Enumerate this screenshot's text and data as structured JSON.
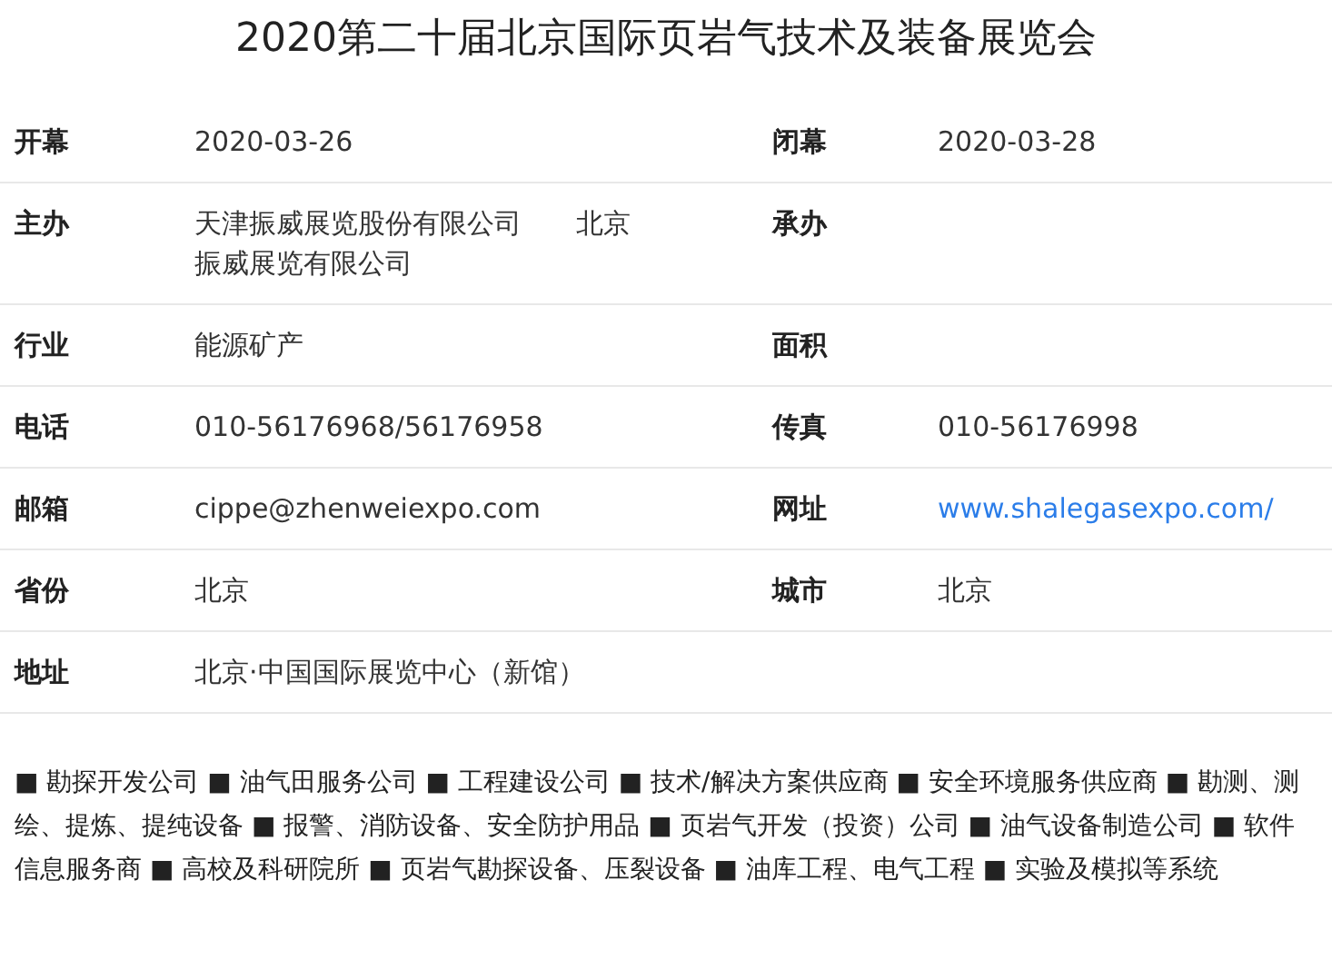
{
  "title": "2020第二十届北京国际页岩气技术及装备展览会",
  "rows": [
    {
      "cells": [
        {
          "label": "开幕",
          "value": "2020-03-26"
        },
        {
          "label": "闭幕",
          "value": "2020-03-28"
        }
      ]
    },
    {
      "cells": [
        {
          "label": "主办",
          "value": "天津振威展览股份有限公司　　北京振威展览有限公司"
        },
        {
          "label": "承办"
        }
      ]
    },
    {
      "cells": [
        {
          "label": "行业",
          "value": "能源矿产"
        },
        {
          "label": "面积"
        }
      ]
    },
    {
      "cells": [
        {
          "label": "电话",
          "value": "010-56176968/56176958"
        },
        {
          "label": "传真",
          "value": "010-56176998"
        }
      ]
    },
    {
      "cells": [
        {
          "label": "邮箱",
          "value": "cippe@zhenweiexpo.com"
        },
        {
          "label": "网址",
          "value": "www.shalegasexpo.com/",
          "kind": "link"
        }
      ]
    },
    {
      "cells": [
        {
          "label": "省份",
          "value": "北京"
        },
        {
          "label": "城市",
          "value": "北京"
        }
      ]
    },
    {
      "cells": [
        {
          "label": "地址",
          "value": "北京·中国国际展览中心（新馆）"
        }
      ]
    }
  ],
  "categories": "■ 勘探开发公司 ■ 油气田服务公司 ■ 工程建设公司 ■ 技术/解决方案供应商 ■ 安全环境服务供应商 ■ 勘测、测绘、提炼、提纯设备 ■ 报警、消防设备、安全防护用品 ■ 页岩气开发（投资）公司 ■ 油气设备制造公司 ■ 软件信息服务商 ■ 高校及科研院所 ■ 页岩气勘探设备、压裂设备 ■ 油库工程、电气工程 ■ 实验及模拟等系统"
}
